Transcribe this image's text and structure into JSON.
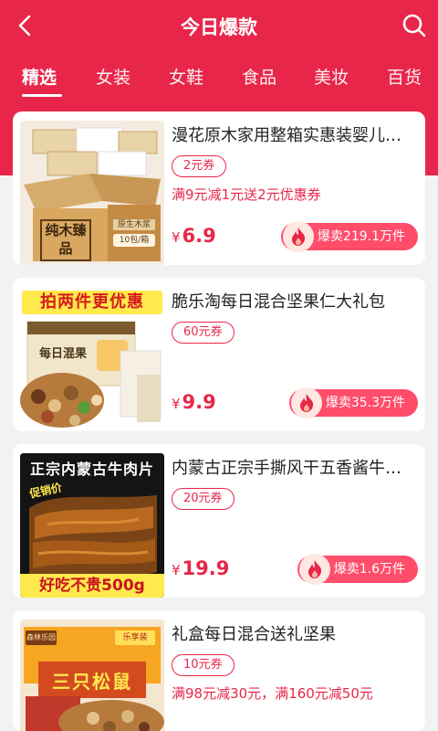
{
  "header": {
    "title": "今日爆款",
    "back_icon": "chevron-left-icon",
    "search_icon": "search-icon"
  },
  "tabs": [
    {
      "label": "精选",
      "active": true
    },
    {
      "label": "女装",
      "active": false
    },
    {
      "label": "女鞋",
      "active": false
    },
    {
      "label": "食品",
      "active": false
    },
    {
      "label": "美妆",
      "active": false
    },
    {
      "label": "百货",
      "active": false
    }
  ],
  "products": [
    {
      "name": "漫花原木家用整箱实惠装婴儿纸巾抽纸",
      "coupon": "2元券",
      "promo": "满9元减1元送2元优惠券",
      "currency": "¥",
      "price": "6.9",
      "sales": "爆卖219.1万件",
      "image": {
        "box_text": "纯木臻品",
        "side_text": "原生木浆",
        "badge": "10包/箱"
      }
    },
    {
      "name": "脆乐淘每日混合坚果仁大礼包",
      "coupon": "60元券",
      "promo": "",
      "currency": "¥",
      "price": "9.9",
      "sales": "爆卖35.3万件",
      "image": {
        "banner": "拍两件更优惠",
        "box_text": "每日混果"
      }
    },
    {
      "name": "内蒙古正宗手撕风干五香酱牛肉片",
      "coupon": "20元券",
      "promo": "",
      "currency": "¥",
      "price": "19.9",
      "sales": "爆卖1.6万件",
      "image": {
        "top_text": "正宗内蒙古牛肉片",
        "tag": "促销价",
        "bottom_text": "好吃不贵500g"
      }
    },
    {
      "name": "礼盒每日混合送礼坚果",
      "coupon": "10元券",
      "promo": "满98元减30元，满160元减50元",
      "currency": "¥",
      "price": "",
      "sales": "",
      "image": {
        "box_text": "三只松鼠",
        "logo_text": "森林乐园",
        "tag": "乐享装"
      }
    }
  ],
  "colors": {
    "brand": "#e8264a",
    "sales_pill": "#ff4d6a",
    "fire": "#e8264a"
  }
}
